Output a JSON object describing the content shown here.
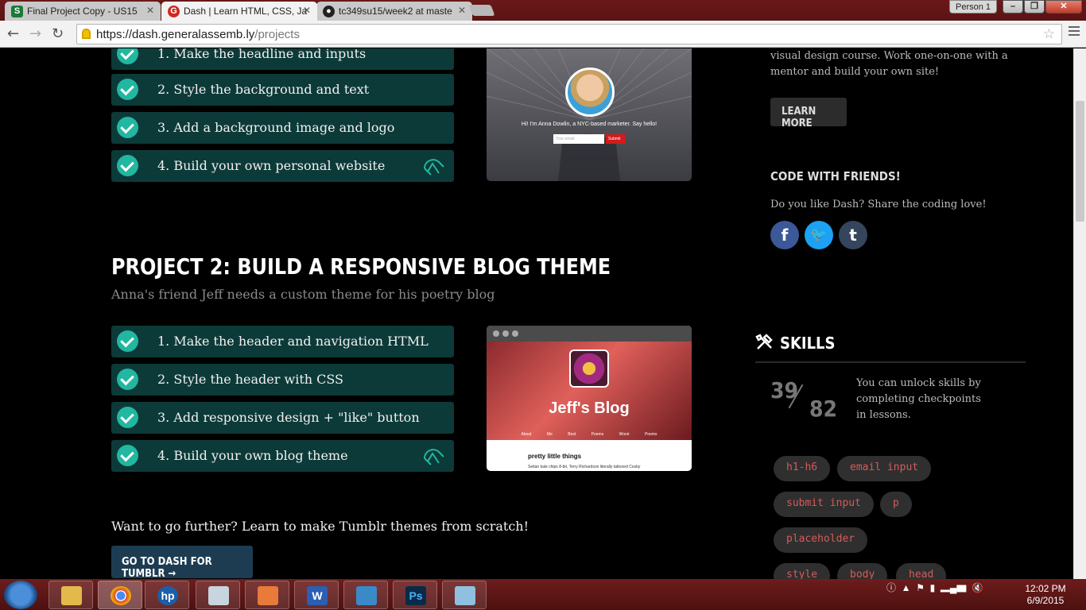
{
  "browser": {
    "tabs": [
      {
        "title": "Final Project Copy - US15",
        "icon": "S"
      },
      {
        "title": "Dash | Learn HTML, CSS, Ja",
        "icon": "GA"
      },
      {
        "title": "tc349su15/week2 at maste",
        "icon": "github"
      }
    ],
    "profile": "Person 1",
    "url_host": "https://dash.generalassemb.ly",
    "url_path": "/projects",
    "window_buttons": [
      "–",
      "❐",
      "✕"
    ]
  },
  "project1": {
    "steps": [
      "1. Make the headline and inputs",
      "2. Style the background and text",
      "3. Add a background image and logo",
      "4. Build your own personal website"
    ],
    "preview": {
      "hello": "Hi! I'm Anna Dowlin, a NYC-based marketer. Say hello!",
      "email_placeholder": "Your email",
      "submit": "Submit"
    }
  },
  "project2": {
    "title": "PROJECT 2: BUILD A RESPONSIVE BLOG THEME",
    "subtitle": "Anna's friend Jeff needs a custom theme for his poetry blog",
    "steps": [
      "1. Make the header and navigation HTML",
      "2. Style the header with CSS",
      "3. Add responsive design + \"like\" button",
      "4. Build your own blog theme"
    ],
    "preview": {
      "blog_title": "Jeff's Blog",
      "nav": "About Me Best Poems Worst Poems",
      "post_title": "pretty little things",
      "post_text": "Seitan kale chips 8-bit, Terry Richardson literally tattooed Cosby"
    }
  },
  "further": {
    "text": "Want to go further? Learn to make Tumblr themes from scratch!",
    "button": "GO TO DASH FOR TUMBLR →"
  },
  "sidebar": {
    "course_desc": "visual design course. Work one-on-one with a mentor and build your own site!",
    "learn_more": "LEARN MORE",
    "code_with_friends": "CODE WITH FRIENDS!",
    "share_text": "Do you like Dash? Share the coding love!",
    "social": [
      {
        "name": "facebook",
        "glyph": "f",
        "color": "#3b5998"
      },
      {
        "name": "twitter",
        "glyph": "🐦",
        "color": "#1da1f2"
      },
      {
        "name": "tumblr",
        "glyph": "t",
        "color": "#35465c"
      }
    ],
    "skills_title": "SKILLS",
    "skills_done": "39",
    "skills_total": "82",
    "skills_desc": "You can unlock skills by completing checkpoints in lessons.",
    "skill_tags": [
      "h1-h6",
      "email input",
      "submit input",
      "p",
      "placeholder",
      "style",
      "body",
      "head"
    ]
  },
  "taskbar": {
    "apps": [
      "explorer",
      "chrome",
      "hp",
      "calculator",
      "paint",
      "W",
      "photo-viewer",
      "Ps",
      "notepad"
    ],
    "time": "12:02 PM",
    "date": "6/9/2015"
  },
  "colors": {
    "step_bg": "#0c3a38",
    "check": "#21b7a0",
    "tag_text": "#d75a5a",
    "tumblr_btn": "#1d3c52"
  }
}
